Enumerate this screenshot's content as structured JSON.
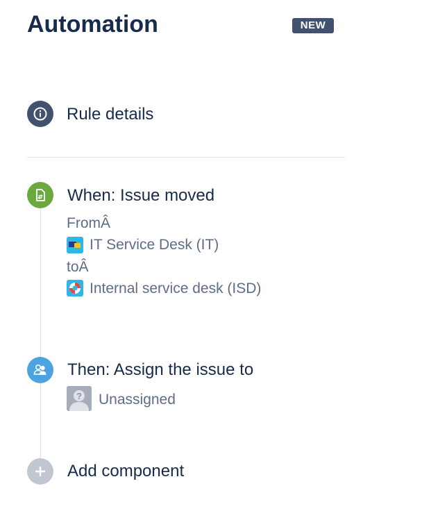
{
  "header": {
    "title": "Automation",
    "badge": "NEW"
  },
  "rule_details": {
    "label": "Rule details"
  },
  "trigger": {
    "label": "When: Issue moved",
    "from_label": "FromÂ",
    "from_project": "IT Service Desk (IT)",
    "to_label": "toÂ",
    "to_project": "Internal service desk (ISD)"
  },
  "action": {
    "label": "Then: Assign the issue to",
    "assignee": "Unassigned"
  },
  "add_component": {
    "label": "Add component"
  },
  "colors": {
    "title": "#172b4d",
    "badge_bg": "#42526e",
    "info_circle": "#42526e",
    "trigger_circle": "#6aa840",
    "action_circle": "#4da3e0",
    "add_circle": "#c1c7d0",
    "secondary_text": "#5e6c84"
  },
  "icons": {
    "rule_details": "info-icon",
    "trigger": "issue-moved-icon",
    "action": "assign-user-icon",
    "add": "plus-icon",
    "from_project": "it-service-desk-project-icon",
    "to_project": "lifebuoy-project-icon",
    "assignee": "unassigned-avatar-icon"
  }
}
